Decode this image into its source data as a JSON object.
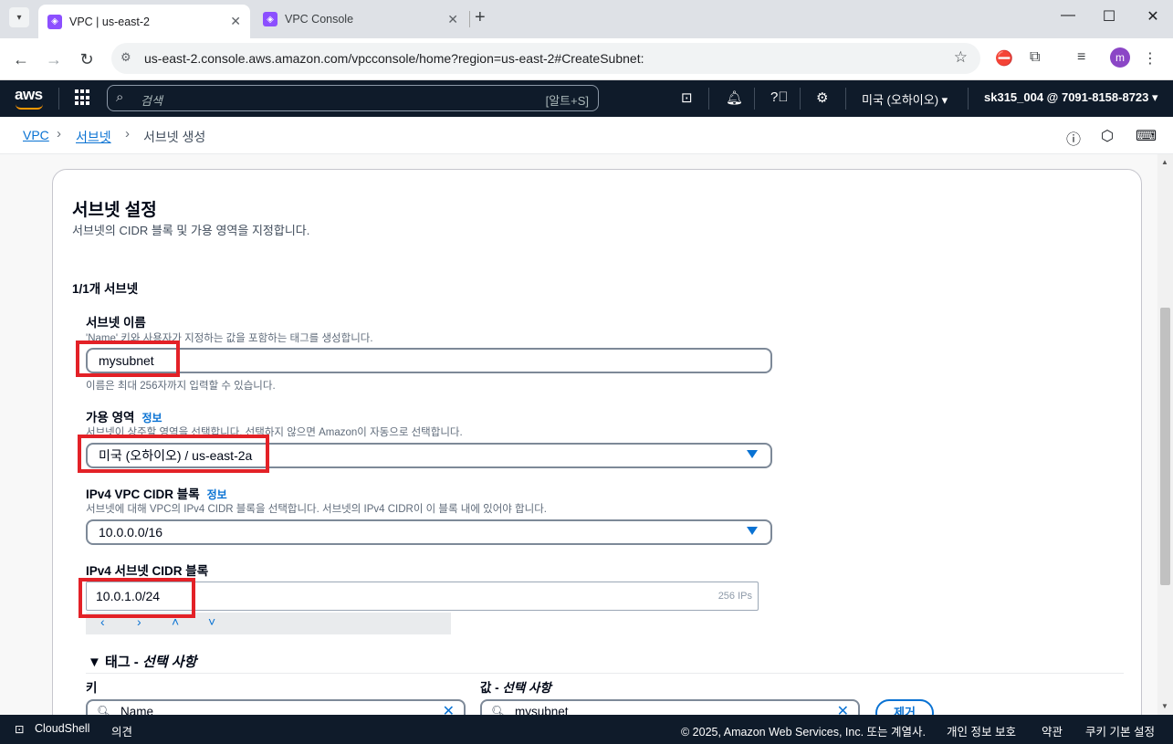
{
  "browser": {
    "tabs": [
      {
        "title": "VPC | us-east-2",
        "active": true
      },
      {
        "title": "VPC Console",
        "active": false
      }
    ],
    "url": "us-east-2.console.aws.amazon.com/vpcconsole/home?region=us-east-2#CreateSubnet:",
    "profile_initial": "m"
  },
  "aws_header": {
    "logo": "aws",
    "search_placeholder": "검색",
    "search_shortcut": "[알트+S]",
    "region": "미국 (오하이오) ▾",
    "account": "sk315_004 @ 7091-8158-8723 ▾"
  },
  "breadcrumb": {
    "items": [
      "VPC",
      "서브넷",
      "서브넷 생성"
    ]
  },
  "subnet_settings": {
    "title": "서브넷 설정",
    "description": "서브넷의 CIDR 블록 및 가용 영역을 지정합니다.",
    "subnet_count": "1/1개 서브넷",
    "name": {
      "label": "서브넷 이름",
      "description": "'Name' 키와 사용자가 지정하는 값을 포함하는 태그를 생성합니다.",
      "value": "mysubnet",
      "constraint": "이름은 최대 256자까지 입력할 수 있습니다."
    },
    "availability_zone": {
      "label": "가용 영역",
      "info": "정보",
      "description": "서브넷이 상주할 영역을 선택합니다. 선택하지 않으면 Amazon이 자동으로 선택합니다.",
      "value": "미국 (오하이오) / us-east-2a"
    },
    "vpc_cidr": {
      "label": "IPv4 VPC CIDR 블록",
      "info": "정보",
      "description": "서브넷에 대해 VPC의 IPv4 CIDR 블록을 선택합니다. 서브넷의 IPv4 CIDR이 이 블록 내에 있어야 합니다.",
      "value": "10.0.0.0/16"
    },
    "subnet_cidr": {
      "label": "IPv4 서브넷 CIDR 블록",
      "value": "10.0.1.0/24",
      "ip_count": "256 IPs"
    },
    "tags": {
      "heading": "▼ 태그 - ",
      "heading_optional": "선택 사항",
      "key_label": "키",
      "value_label": "값 - ",
      "value_label_optional": "선택 사항",
      "key_value": "Name",
      "value_value": "mysubnet",
      "remove_label": "제거"
    }
  },
  "footer": {
    "cloudshell": "CloudShell",
    "feedback": "의견",
    "copyright": "© 2025, Amazon Web Services, Inc. 또는 계열사.",
    "privacy": "개인 정보 보호",
    "terms": "약관",
    "cookies": "쿠키 기본 설정"
  },
  "colors": {
    "aws_header_bg": "#0f1b2a",
    "link": "#0972d3",
    "highlight": "#e32127"
  }
}
